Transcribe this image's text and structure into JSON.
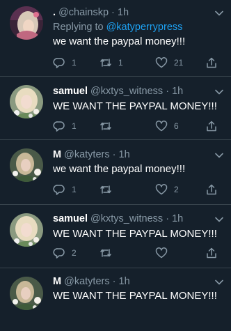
{
  "tweets": [
    {
      "name": ".",
      "handle": "@chainskp",
      "separator": "·",
      "time": "1h",
      "reply_prefix": "Replying to",
      "reply_to": "@katyperrypress",
      "text": "we want the paypal money!!!",
      "replies": "1",
      "retweets": "1",
      "likes": "21",
      "avatar": "woman-with-light-blonde-hair"
    },
    {
      "name": "samuel",
      "handle": "@kxtys_witness",
      "separator": "·",
      "time": "1h",
      "text": "WE WANT THE PAYPAL MONEY!!!",
      "replies": "1",
      "retweets": "",
      "likes": "6",
      "avatar": "blonde-woman-with-flowers"
    },
    {
      "name": "M",
      "handle": "@katyters",
      "separator": "·",
      "time": "1h",
      "text": "we want the paypal money!!!",
      "replies": "1",
      "retweets": "",
      "likes": "2",
      "avatar": "woman-with-flowers"
    },
    {
      "name": "samuel",
      "handle": "@kxtys_witness",
      "separator": "·",
      "time": "1h",
      "text": "WE WANT THE PAYPAL MONEY!!!",
      "replies": "2",
      "retweets": "",
      "likes": "",
      "avatar": "blonde-woman-with-flowers"
    },
    {
      "name": "M",
      "handle": "@katyters",
      "separator": "·",
      "time": "1h",
      "text": "WE WANT THE PAYPAL MONEY!!!",
      "replies": "",
      "retweets": "",
      "likes": "",
      "avatar": "woman-with-flowers"
    }
  ],
  "colors": {
    "background": "#15202b",
    "divider": "#38444d",
    "secondary_text": "#8899a6",
    "link": "#1da1f2"
  },
  "icons": {
    "reply": "reply-icon",
    "retweet": "retweet-icon",
    "like": "like-icon",
    "share": "share-icon",
    "more": "chevron-down-icon"
  }
}
